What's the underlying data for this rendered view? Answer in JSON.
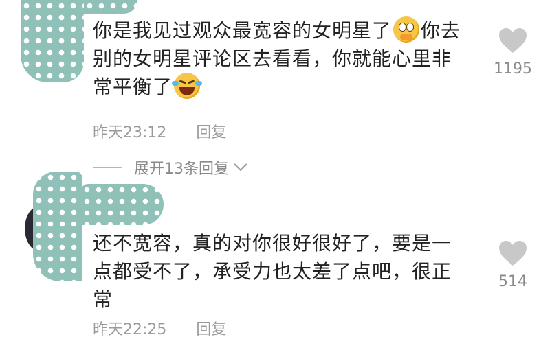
{
  "comments": [
    {
      "text_line1": "你是我见过观众最宽容的女明星了",
      "text_line1b": "你去",
      "text_line2": "别的女明星评论区去看看，你就能心里非",
      "text_line3": "常平衡了",
      "emoji1": "pleading-face-emoji",
      "emoji2": "laughing-crying-emoji",
      "time": "昨天23:12",
      "reply_label": "回复",
      "likes": "1195",
      "expand_label": "展开13条回复"
    },
    {
      "text_line1": "还不宽容，真的对你很好很好了，要是一",
      "text_line2": "点都受不了，承受力也太差了点吧，很正",
      "text_line3": "常",
      "time": "昨天22:25",
      "reply_label": "回复",
      "likes": "514"
    }
  ],
  "colors": {
    "mask": "#8fc1b9",
    "text": "#222222",
    "meta": "#9a9a9a",
    "like_icon": "#c8c8c8"
  }
}
